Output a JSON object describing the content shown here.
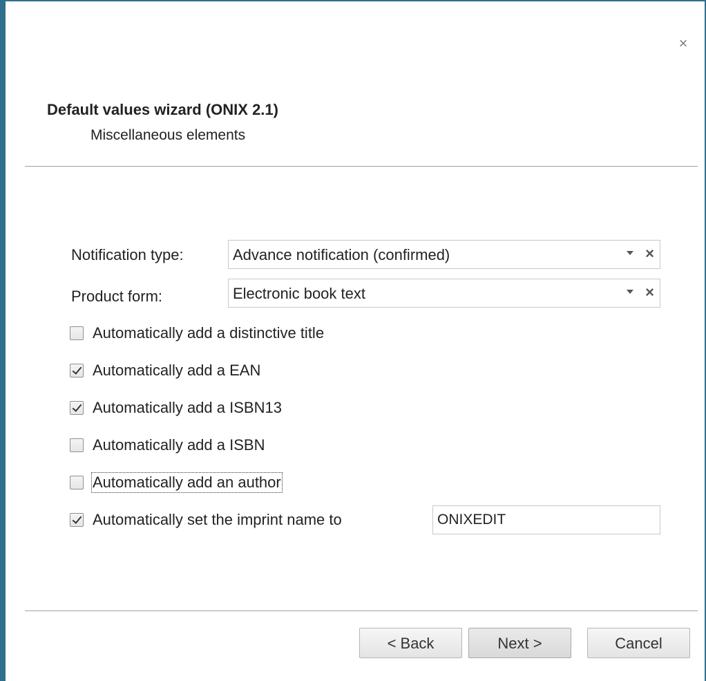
{
  "dialog": {
    "title": "Default values wizard (ONIX 2.1)",
    "subtitle": "Miscellaneous elements",
    "close_icon": "×"
  },
  "fields": {
    "notification_type": {
      "label": "Notification type:",
      "value": "Advance notification (confirmed)"
    },
    "product_form": {
      "label": "Product form:",
      "value": "Electronic book text"
    },
    "clear_icon": "×"
  },
  "options": [
    {
      "label": "Automatically add a distinctive title",
      "checked": false
    },
    {
      "label": "Automatically add a EAN",
      "checked": true
    },
    {
      "label": "Automatically add a ISBN13",
      "checked": true
    },
    {
      "label": "Automatically add a ISBN",
      "checked": false
    },
    {
      "label": "Automatically add an author",
      "checked": false
    },
    {
      "label": "Automatically set the imprint name to",
      "checked": true
    }
  ],
  "imprint_name": "ONIXEDIT",
  "buttons": {
    "back": "< Back",
    "next": "Next >",
    "cancel": "Cancel"
  },
  "colors": {
    "frame_border": "#2e6f8e"
  }
}
